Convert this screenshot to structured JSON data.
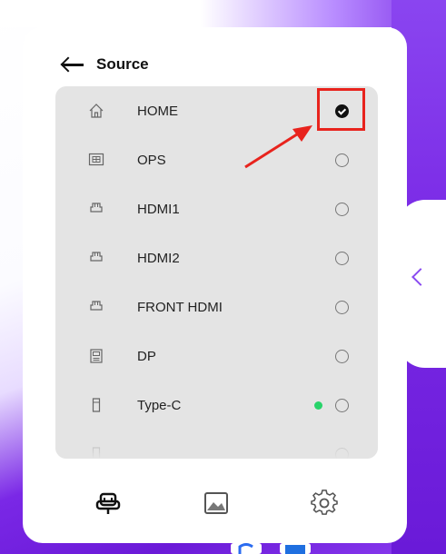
{
  "header": {
    "title": "Source"
  },
  "sources": [
    {
      "label": "HOME",
      "icon": "home-icon",
      "selected": true,
      "active_signal": false
    },
    {
      "label": "OPS",
      "icon": "ops-icon",
      "selected": false,
      "active_signal": false
    },
    {
      "label": "HDMI1",
      "icon": "hdmi-port-icon",
      "selected": false,
      "active_signal": false
    },
    {
      "label": "HDMI2",
      "icon": "hdmi-port-icon",
      "selected": false,
      "active_signal": false
    },
    {
      "label": "FRONT HDMI",
      "icon": "hdmi-port-icon",
      "selected": false,
      "active_signal": false
    },
    {
      "label": "DP",
      "icon": "displayport-icon",
      "selected": false,
      "active_signal": false
    },
    {
      "label": "Type-C",
      "icon": "usb-c-icon",
      "selected": false,
      "active_signal": true
    },
    {
      "label": "",
      "icon": "usb-c-icon",
      "selected": false,
      "active_signal": false
    }
  ],
  "bottom_nav": [
    {
      "name": "source-tab",
      "icon": "source-icon"
    },
    {
      "name": "image-tab",
      "icon": "image-icon"
    },
    {
      "name": "settings-tab",
      "icon": "gear-icon"
    }
  ],
  "colors": {
    "highlight": "#e8231d",
    "signal": "#28d36a",
    "accent": "#8a4cf0"
  }
}
